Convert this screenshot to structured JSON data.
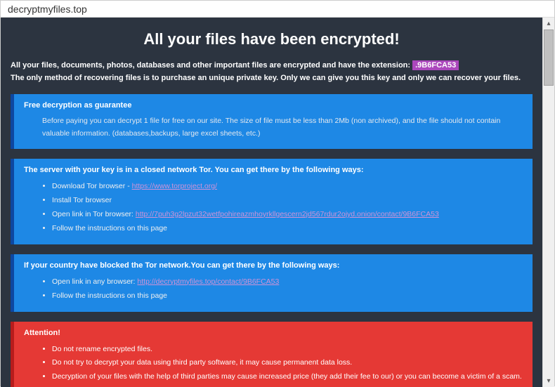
{
  "address": "decryptmyfiles.top",
  "title": "All your files have been encrypted!",
  "intro_line1_a": "All your files, documents, photos, databases and other important files are encrypted and have the extension: ",
  "extension": ".9B6FCA53",
  "intro_line2": "The only method of recovering files is to purchase an unique private key. Only we can give you this key and only we can recover your files.",
  "box1": {
    "header": "Free decryption as guarantee",
    "text": "Before paying you can decrypt 1 file for free on our site. The size of file must be less than 2Mb (non archived), and the file should not contain valuable information. (databases,backups, large excel sheets, etc.)"
  },
  "box2": {
    "header": "The server with your key is in a closed network Tor. You can get there by the following ways:",
    "items": {
      "i0_text": "Download Tor browser - ",
      "i0_link": "https://www.torproject.org/",
      "i1": "Install Tor browser",
      "i2_text": "Open link in Tor browser: ",
      "i2_link": "http://7puh3g2lpzut32wetfpohireazmhoyrkllgescern2jd567rdur2ojyd.onion/contact/9B6FCA53",
      "i3": "Follow the instructions on this page"
    }
  },
  "box3": {
    "header": "If your country have blocked the Tor network.You can get there by the following ways:",
    "items": {
      "i0_text": "Open link in any browser: ",
      "i0_link": "http://decryptmyfiles.top/contact/9B6FCA53",
      "i1": "Follow the instructions on this page"
    }
  },
  "box4": {
    "header": "Attention!",
    "items": {
      "i0": "Do not rename encrypted files.",
      "i1": "Do not try to decrypt your data using third party software, it may cause permanent data loss.",
      "i2": "Decryption of your files with the help of third parties may cause increased price (they add their fee to our) or you can become a victim of a scam."
    }
  }
}
